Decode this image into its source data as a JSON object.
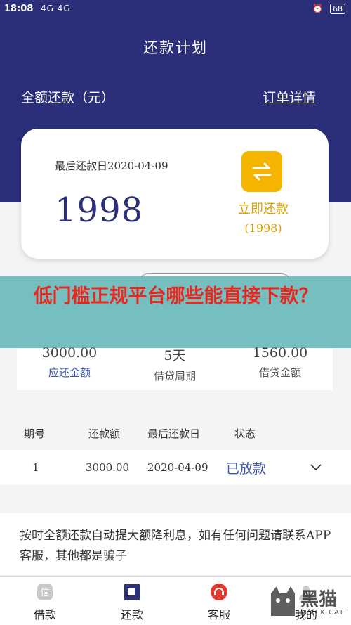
{
  "status_bar": {
    "time": "18:08",
    "signal": "4G 4G",
    "battery": "68"
  },
  "header": {
    "title": "还款计划",
    "total_label": "全额还款（元）",
    "order_details": "订单详情"
  },
  "card": {
    "due_date": "最后还款日2020-04-09",
    "amount": "1998",
    "repay_button_label": "立即还款",
    "repay_amount": "(1998)"
  },
  "banner": {
    "text": "低门槛正规平台哪些能直接下款？"
  },
  "stats": [
    {
      "value": "3000.00",
      "label": "应还金额"
    },
    {
      "value": "5天",
      "label": "借贷周期"
    },
    {
      "value": "1560.00",
      "label": "借贷金额"
    }
  ],
  "table": {
    "headers": [
      "期号",
      "还款额",
      "最后还款日",
      "状态"
    ],
    "rows": [
      {
        "period": "1",
        "amount": "3000.00",
        "due": "2020-04-09",
        "status": "已放款"
      }
    ]
  },
  "notice": "按时全额还款自动提大额降利息，如有任何问题请联系APP客服，其他都是骗子",
  "tabs": [
    {
      "label": "借款",
      "icon": "loan-icon"
    },
    {
      "label": "还款",
      "icon": "repay-icon"
    },
    {
      "label": "客服",
      "icon": "customer-service-icon"
    },
    {
      "label": "我的",
      "icon": "profile-icon"
    }
  ],
  "watermark": {
    "text": "黑猫",
    "sub": "BLACK CAT"
  },
  "colors": {
    "brand": "#2b2f7a",
    "accent": "#f5b400",
    "banner": "#6cbabc",
    "banner_text": "#e8271f"
  }
}
